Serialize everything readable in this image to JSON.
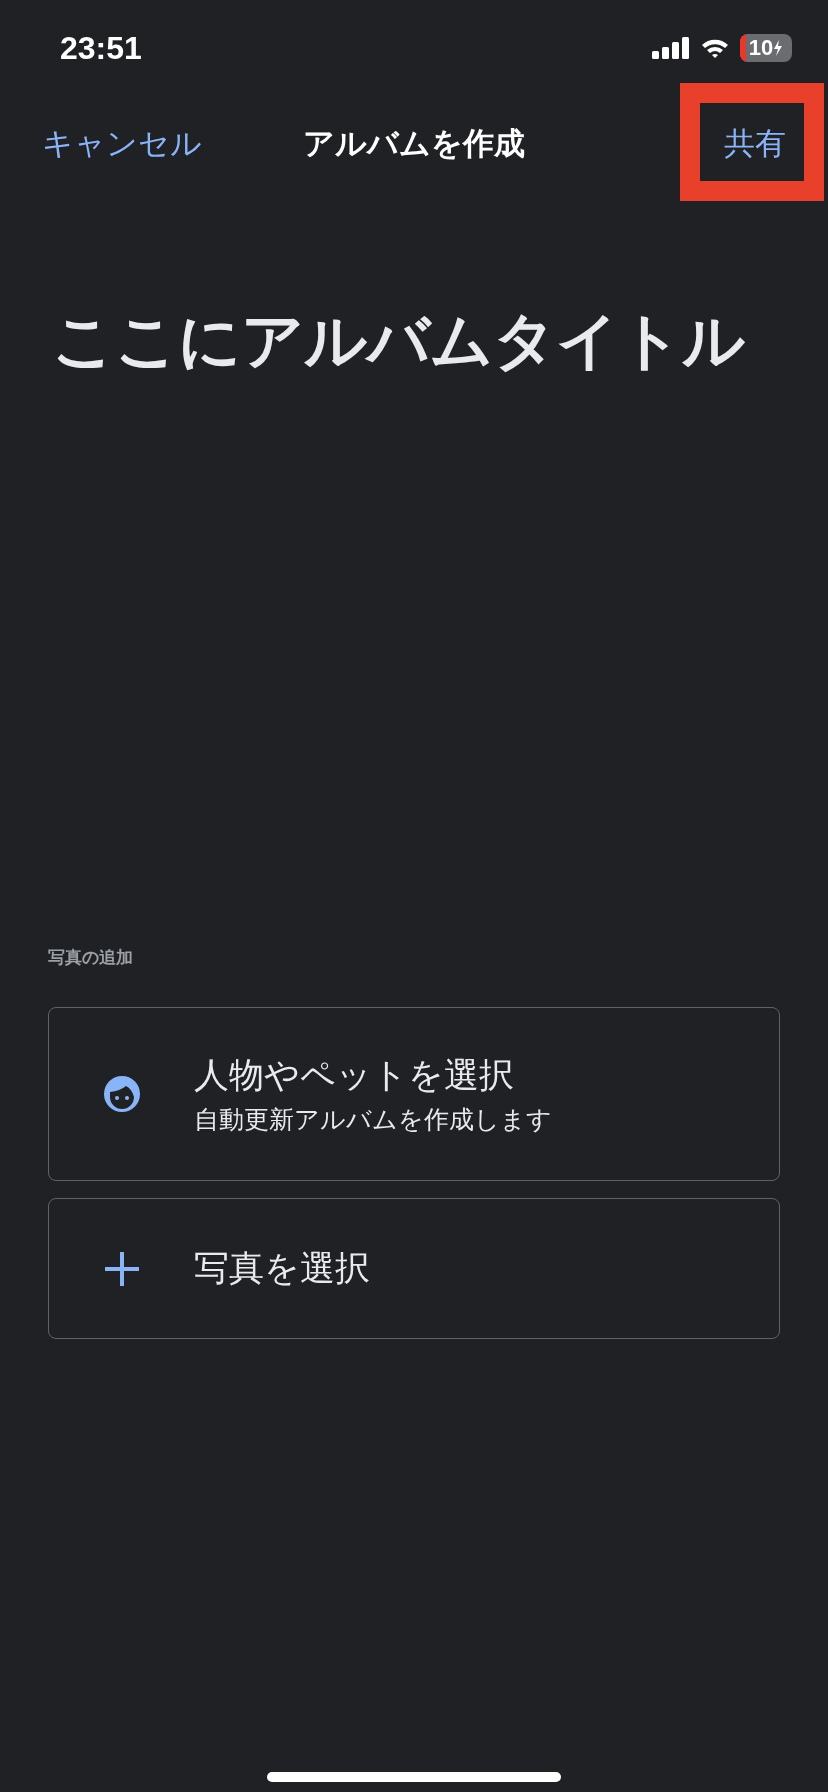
{
  "status_bar": {
    "time": "23:51",
    "battery": "10"
  },
  "nav": {
    "cancel": "キャンセル",
    "title": "アルバムを作成",
    "share": {
      "label": "共有",
      "highlighted": true
    }
  },
  "album_title": "ここにアルバムタイトル",
  "section_label": "写真の追加",
  "options": [
    {
      "kind": "face",
      "title": "人物やペットを選択",
      "subtitle": "自動更新アルバムを作成します"
    },
    {
      "kind": "plus",
      "title": "写真を選択"
    }
  ]
}
